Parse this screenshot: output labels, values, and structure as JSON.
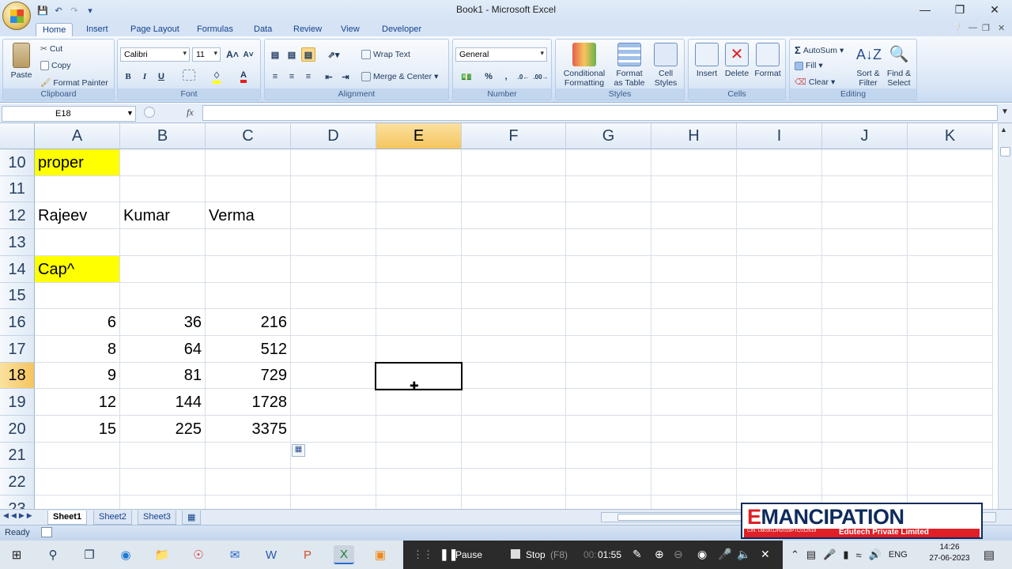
{
  "window": {
    "title": "Book1 - Microsoft Excel"
  },
  "tabs": [
    "Home",
    "Insert",
    "Page Layout",
    "Formulas",
    "Data",
    "Review",
    "View",
    "Developer"
  ],
  "active_tab": "Home",
  "ribbon": {
    "clipboard": {
      "label": "Clipboard",
      "paste": "Paste",
      "cut": "Cut",
      "copy": "Copy",
      "format_painter": "Format Painter"
    },
    "font": {
      "label": "Font",
      "font_name": "Calibri",
      "font_size": "11"
    },
    "alignment": {
      "label": "Alignment",
      "wrap_text": "Wrap Text",
      "merge_center": "Merge & Center"
    },
    "number": {
      "label": "Number",
      "format": "General"
    },
    "styles": {
      "label": "Styles",
      "conditional": [
        "Conditional",
        "Formatting"
      ],
      "format_table": [
        "Format",
        "as Table"
      ],
      "cell_styles": [
        "Cell",
        "Styles"
      ]
    },
    "cells": {
      "label": "Cells",
      "insert": "Insert",
      "delete": "Delete",
      "format": "Format"
    },
    "editing": {
      "label": "Editing",
      "autosum": "AutoSum",
      "fill": "Fill",
      "clear": "Clear",
      "sort": [
        "Sort &",
        "Filter"
      ],
      "find": [
        "Find &",
        "Select"
      ]
    }
  },
  "formula_bar": {
    "name_box": "E18",
    "fx": "fx",
    "value": ""
  },
  "columns": [
    "A",
    "B",
    "C",
    "D",
    "E",
    "F",
    "G",
    "H",
    "I",
    "J",
    "K"
  ],
  "selected_column": "E",
  "rows": [
    "10",
    "11",
    "12",
    "13",
    "14",
    "15",
    "16",
    "17",
    "18",
    "19",
    "20",
    "21",
    "22",
    "23"
  ],
  "selected_row": "18",
  "cells": {
    "A10": "proper",
    "A12": "Rajeev",
    "B12": "Kumar",
    "C12": "Verma",
    "A14": "Cap^",
    "A16": "6",
    "B16": "36",
    "C16": "216",
    "A17": "8",
    "B17": "64",
    "C17": "512",
    "A18": "9",
    "B18": "81",
    "C18": "729",
    "A19": "12",
    "B19": "144",
    "C19": "1728",
    "A20": "15",
    "B20": "225",
    "C20": "3375"
  },
  "highlight_color": "#ffff00",
  "sheets": [
    "Sheet1",
    "Sheet2",
    "Sheet3"
  ],
  "active_sheet": "Sheet1",
  "status": {
    "text": "Ready"
  },
  "recorder": {
    "pause": "Pause",
    "stop": "Stop",
    "stop_key": "(F8)",
    "time_dim": "00:",
    "time": "01:55"
  },
  "taskbar": {
    "lang": "ENG",
    "time": "14:26",
    "date": "27-06-2023"
  },
  "brand": {
    "name_first": "E",
    "name_rest": "MANCIPATION",
    "cin": "CIN: U80301JH2019PTC012619",
    "tagline": "Edutech Private Limited"
  }
}
